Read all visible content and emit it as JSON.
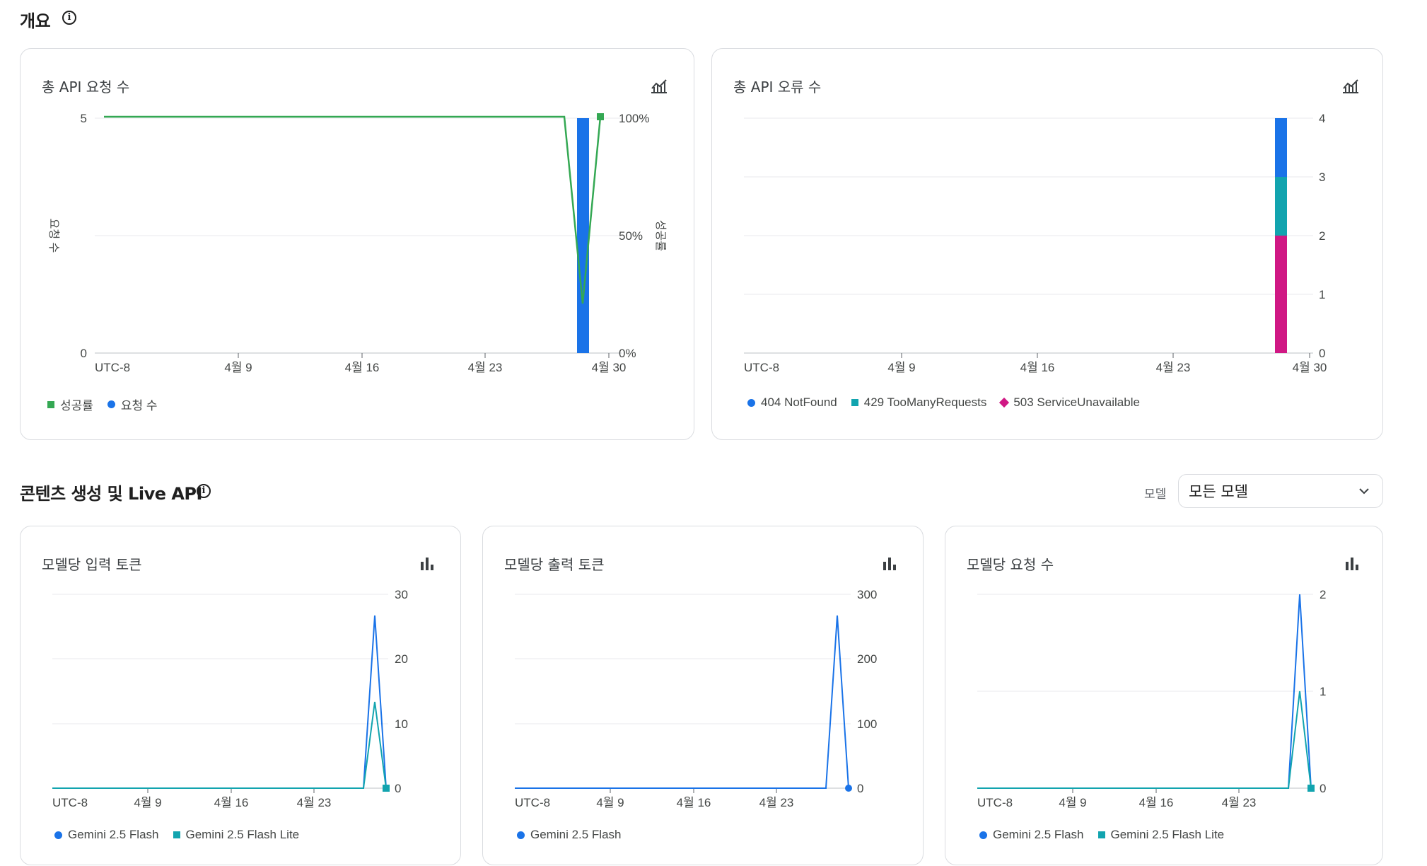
{
  "overview": {
    "title": "개요"
  },
  "cards": {
    "requests": {
      "title": "총 API 요청 수",
      "icon": "chart-line-icon",
      "y_left_ticks": [
        "5",
        "0"
      ],
      "y_right_ticks": [
        "100%",
        "50%",
        "0%"
      ],
      "y_left_label": "요청 수",
      "y_right_label": "성공률",
      "x_ticks": [
        "UTC-8",
        "4월 9",
        "4월 16",
        "4월 23",
        "4월 30"
      ],
      "legend": [
        "성공률",
        "요청 수"
      ]
    },
    "errors": {
      "title": "총 API 오류 수",
      "icon": "chart-line-icon",
      "y_ticks": [
        "4",
        "3",
        "2",
        "1",
        "0"
      ],
      "x_ticks": [
        "UTC-8",
        "4월 9",
        "4월 16",
        "4월 23",
        "4월 30"
      ],
      "legend": [
        "404 NotFound",
        "429 TooManyRequests",
        "503 ServiceUnavailable"
      ]
    },
    "input_tokens": {
      "title": "모델당 입력 토큰",
      "y_ticks": [
        "30",
        "20",
        "10",
        "0"
      ],
      "x_ticks": [
        "UTC-8",
        "4월 9",
        "4월 16",
        "4월 23"
      ],
      "legend": [
        "Gemini 2.5 Flash",
        "Gemini 2.5 Flash Lite"
      ]
    },
    "output_tokens": {
      "title": "모델당 출력 토큰",
      "y_ticks": [
        "300",
        "200",
        "100",
        "0"
      ],
      "x_ticks": [
        "UTC-8",
        "4월 9",
        "4월 16",
        "4월 23"
      ],
      "legend": [
        "Gemini 2.5 Flash"
      ]
    },
    "model_requests": {
      "title": "모델당 요청 수",
      "y_ticks": [
        "2",
        "1",
        "0"
      ],
      "x_ticks": [
        "UTC-8",
        "4월 9",
        "4월 16",
        "4월 23"
      ],
      "legend": [
        "Gemini 2.5 Flash",
        "Gemini 2.5 Flash Lite"
      ]
    }
  },
  "content_section": {
    "title": "콘텐츠 생성 및 Live API",
    "model_label": "모델",
    "model_select_value": "모든 모델"
  },
  "colors": {
    "blue": "#1a73e8",
    "green": "#34a853",
    "teal": "#12a4af",
    "magenta": "#d01884",
    "grid": "#e8eaed"
  },
  "chart_data": [
    {
      "type": "bar",
      "title": "총 API 요청 수",
      "ylabel": "요청 수",
      "y2label": "성공률",
      "ylim": [
        0,
        5
      ],
      "y2lim": [
        0,
        100
      ],
      "x_ticks": [
        "UTC-8",
        "4월 9",
        "4월 16",
        "4월 23",
        "4월 30"
      ],
      "series": [
        {
          "name": "요청 수",
          "kind": "bar",
          "x": [
            "4월 29"
          ],
          "values": [
            5
          ]
        },
        {
          "name": "성공률",
          "kind": "line",
          "x": [
            "UTC-8",
            "4월 28",
            "4월 29",
            "4월 30"
          ],
          "values": [
            100,
            100,
            20,
            100
          ]
        }
      ]
    },
    {
      "type": "bar",
      "title": "총 API 오류 수",
      "ylim": [
        0,
        4
      ],
      "stacked": true,
      "x_ticks": [
        "UTC-8",
        "4월 9",
        "4월 16",
        "4월 23",
        "4월 30"
      ],
      "categories": [
        "4월 29"
      ],
      "series": [
        {
          "name": "503 ServiceUnavailable",
          "values": [
            2
          ]
        },
        {
          "name": "429 TooManyRequests",
          "values": [
            1
          ]
        },
        {
          "name": "404 NotFound",
          "values": [
            1
          ]
        }
      ]
    },
    {
      "type": "line",
      "title": "모델당 입력 토큰",
      "ylim": [
        0,
        30
      ],
      "x_ticks": [
        "UTC-8",
        "4월 9",
        "4월 16",
        "4월 23"
      ],
      "series": [
        {
          "name": "Gemini 2.5 Flash",
          "values": [
            0,
            0,
            28,
            0
          ]
        },
        {
          "name": "Gemini 2.5 Flash Lite",
          "values": [
            0,
            0,
            14,
            0
          ]
        }
      ]
    },
    {
      "type": "line",
      "title": "모델당 출력 토큰",
      "ylim": [
        0,
        300
      ],
      "x_ticks": [
        "UTC-8",
        "4월 9",
        "4월 16",
        "4월 23"
      ],
      "series": [
        {
          "name": "Gemini 2.5 Flash",
          "values": [
            0,
            0,
            280,
            0
          ]
        }
      ]
    },
    {
      "type": "line",
      "title": "모델당 요청 수",
      "ylim": [
        0,
        2
      ],
      "x_ticks": [
        "UTC-8",
        "4월 9",
        "4월 16",
        "4월 23"
      ],
      "series": [
        {
          "name": "Gemini 2.5 Flash",
          "values": [
            0,
            0,
            2,
            0
          ]
        },
        {
          "name": "Gemini 2.5 Flash Lite",
          "values": [
            0,
            0,
            1,
            0
          ]
        }
      ]
    }
  ]
}
